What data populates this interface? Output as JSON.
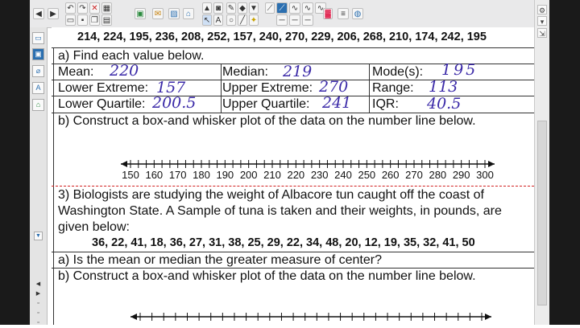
{
  "toolbar": {
    "items": [
      "back-icon",
      "forward-icon",
      "undo-icon",
      "redo-icon",
      "delete-icon",
      "table-icon",
      "screen-icon",
      "media-icon",
      "gallery-icon",
      "pointer-icon",
      "pen-icon",
      "text-icon",
      "eraser-icon",
      "shape-icon",
      "line-icon",
      "fill-icon",
      "properties-icon",
      "capture-icon"
    ]
  },
  "problem2": {
    "data_line": "214, 224, 195, 236, 208, 252, 157, 240, 270, 229, 206, 268, 210, 174, 242, 195",
    "prompt_a": "a) Find each value below.",
    "labels": {
      "mean": "Mean:",
      "median": "Median:",
      "mode": "Mode(s):",
      "lower_extreme": "Lower Extreme:",
      "upper_extreme": "Upper Extreme:",
      "range": "Range:",
      "lower_quartile": "Lower Quartile:",
      "upper_quartile": "Upper Quartile:",
      "iqr": "IQR:"
    },
    "answers": {
      "mean": "220",
      "median": "219",
      "mode": "195",
      "lower_extreme": "157",
      "upper_extreme": "270",
      "range": "113",
      "lower_quartile": "200.5",
      "upper_quartile": "241",
      "iqr": "40.5"
    },
    "prompt_b": "b) Construct a box-and whisker plot of the data on the number line below.",
    "number_line": [
      "150",
      "160",
      "170",
      "180",
      "190",
      "200",
      "210",
      "220",
      "230",
      "240",
      "250",
      "260",
      "270",
      "280",
      "290",
      "300"
    ]
  },
  "problem3": {
    "text_line1": "3) Biologists are studying the weight of Albacore tun caught off the coast of",
    "text_line2": "Washington State. A Sample of tuna is taken and their weights, in pounds, are",
    "text_line3": "given below:",
    "data_line": "36, 22, 41, 18, 36, 27, 31, 38, 25, 29, 22, 34, 48, 20, 12, 19, 35, 32, 41, 50",
    "prompt_a": "a) Is the mean or median the greater measure of center?",
    "prompt_b": "b) Construct a box-and whisker plot of the data on the number line below."
  },
  "colors": {
    "ink": "#3b2aa8",
    "divider": "#d22020",
    "accent": "#2b6fb0"
  }
}
